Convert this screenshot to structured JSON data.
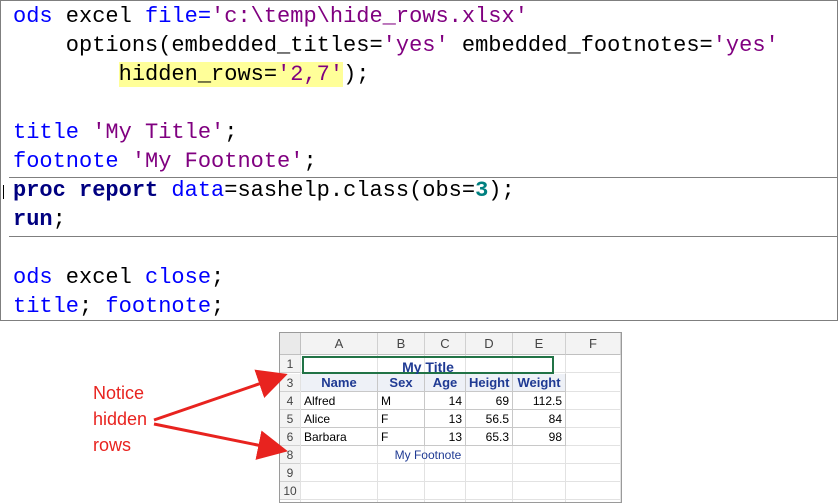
{
  "editor": {
    "lines": [
      {
        "segments": [
          {
            "t": "ods",
            "c": "kw"
          },
          {
            "t": " excel ",
            "c": ""
          },
          {
            "t": "file=",
            "c": "kw"
          },
          {
            "t": "'c:\\temp\\hide_rows.xlsx'",
            "c": "str"
          }
        ]
      },
      {
        "segments": [
          {
            "t": "    options(embedded_titles=",
            "c": ""
          },
          {
            "t": "'yes'",
            "c": "str"
          },
          {
            "t": " embedded_footnotes=",
            "c": ""
          },
          {
            "t": "'yes'",
            "c": "str"
          }
        ]
      },
      {
        "segments": [
          {
            "t": "        ",
            "c": ""
          },
          {
            "t": "hidden_rows=",
            "c": "hl"
          },
          {
            "t": "'2,7'",
            "c": "hl str"
          },
          {
            "t": ");",
            "c": ""
          }
        ]
      },
      {
        "segments": []
      },
      {
        "segments": [
          {
            "t": "title",
            "c": "kw"
          },
          {
            "t": " 'My Title'",
            "c": "str"
          },
          {
            "t": ";",
            "c": ""
          }
        ]
      },
      {
        "segments": [
          {
            "t": "footnote",
            "c": "kw"
          },
          {
            "t": " 'My Footnote'",
            "c": "str"
          },
          {
            "t": ";",
            "c": ""
          }
        ]
      },
      {
        "segments": [
          {
            "t": "proc report",
            "c": "bold"
          },
          {
            "t": " data",
            "c": "kw"
          },
          {
            "t": "=sashelp.class(obs=",
            "c": ""
          },
          {
            "t": "3",
            "c": "num"
          },
          {
            "t": ");",
            "c": ""
          }
        ]
      },
      {
        "segments": [
          {
            "t": "run",
            "c": "bold"
          },
          {
            "t": ";",
            "c": ""
          }
        ]
      },
      {
        "segments": []
      },
      {
        "segments": [
          {
            "t": "ods",
            "c": "kw"
          },
          {
            "t": " excel ",
            "c": ""
          },
          {
            "t": "close",
            "c": "kw"
          },
          {
            "t": ";",
            "c": ""
          }
        ]
      },
      {
        "segments": [
          {
            "t": "title",
            "c": "kw"
          },
          {
            "t": "; ",
            "c": ""
          },
          {
            "t": "footnote",
            "c": "kw"
          },
          {
            "t": ";",
            "c": ""
          }
        ]
      }
    ]
  },
  "sheet": {
    "columns": [
      "A",
      "B",
      "C",
      "D",
      "E",
      "F"
    ],
    "rows": [
      "1",
      "3",
      "4",
      "5",
      "6",
      "8",
      "9",
      "10"
    ],
    "title": "My Title",
    "headers": [
      "Name",
      "Sex",
      "Age",
      "Height",
      "Weight"
    ],
    "data": [
      [
        "Alfred",
        "M",
        "14",
        "69",
        "112.5"
      ],
      [
        "Alice",
        "F",
        "13",
        "56.5",
        "84"
      ],
      [
        "Barbara",
        "F",
        "13",
        "65.3",
        "98"
      ]
    ],
    "footnote": "My Footnote"
  },
  "annotation": {
    "text_lines": [
      "Notice",
      "hidden",
      "rows"
    ],
    "color": "#e8231f"
  }
}
